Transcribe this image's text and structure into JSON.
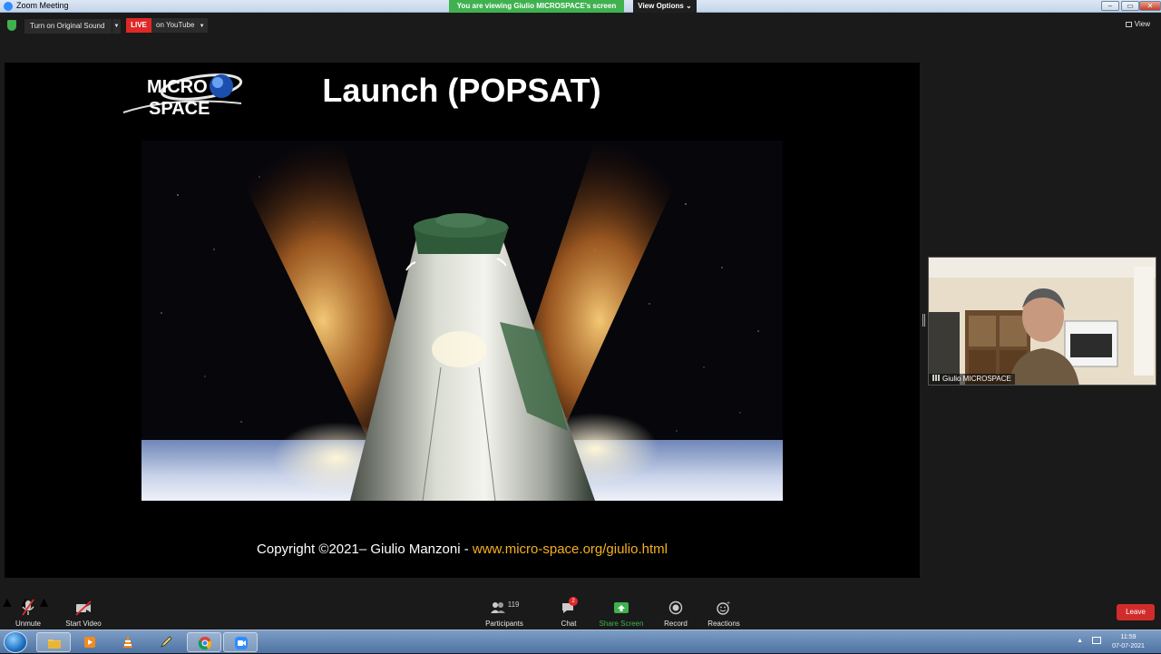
{
  "window": {
    "title": "Zoom Meeting",
    "viewing_banner": "You are viewing Giulio MICROSPACE's screen",
    "view_options": "View Options ⌄"
  },
  "topbar": {
    "original_sound": "Turn on Original Sound",
    "live_label": "LIVE",
    "live_target": "on YouTube",
    "view_label": "View"
  },
  "slide": {
    "logo_line1": "MICRO",
    "logo_line2": "SPACE",
    "title": "Launch (POPSAT)",
    "copyright_prefix": "Copyright ©2021– Giulio Manzoni - ",
    "copyright_url": "www.micro-space.org/giulio.html"
  },
  "participant": {
    "name": "Giulio MICROSPACE"
  },
  "controls": {
    "unmute": "Unmute",
    "start_video": "Start Video",
    "participants_label": "Participants",
    "participants_count": "119",
    "chat_label": "Chat",
    "chat_badge": "2",
    "share_screen": "Share Screen",
    "record": "Record",
    "reactions": "Reactions",
    "leave": "Leave"
  },
  "taskbar": {
    "items": [
      "file-explorer",
      "media-player",
      "vlc",
      "sketch-app",
      "chrome",
      "zoom"
    ],
    "time": "11:59",
    "date": "07-07-2021"
  },
  "colors": {
    "share_green": "#3fb24f",
    "live_red": "#e02828",
    "url_gold": "#f4b020",
    "leave_red": "#d12c2c"
  }
}
